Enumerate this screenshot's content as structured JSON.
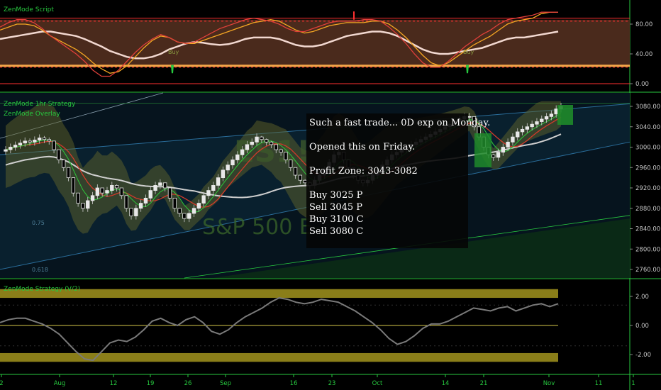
{
  "panes": {
    "top": {
      "title": "ZenMode Script",
      "ticks": [
        {
          "v": 80,
          "label": "80.00"
        },
        {
          "v": 40,
          "label": "40.00"
        },
        {
          "v": 0,
          "label": "0.00"
        }
      ]
    },
    "main": {
      "titles": [
        "ZenMode 1hr Strategy",
        "ZenMode Overlay"
      ],
      "ticks": [
        {
          "v": 3080,
          "label": "3080.00"
        },
        {
          "v": 3040,
          "label": "3040.00"
        },
        {
          "v": 3000,
          "label": "3000.00"
        },
        {
          "v": 2960,
          "label": "2960.00"
        },
        {
          "v": 2920,
          "label": "2920.00"
        },
        {
          "v": 2880,
          "label": "2880.00"
        },
        {
          "v": 2840,
          "label": "2840.00"
        },
        {
          "v": 2800,
          "label": "2800.00"
        },
        {
          "v": 2760,
          "label": "2760.00"
        }
      ],
      "watermark_symbol": "ES1!",
      "watermark_name": "S&P 500 E-",
      "fib_labels": [
        {
          "label": "0.75"
        },
        {
          "label": "0.618"
        }
      ]
    },
    "bottom": {
      "title": "ZenMode Strategy (V/2)",
      "ticks": [
        {
          "v": 2,
          "label": "2.00"
        },
        {
          "v": 0,
          "label": "0.00"
        },
        {
          "v": -2,
          "label": "-2.00"
        }
      ]
    }
  },
  "signals": [
    {
      "label": "Buy"
    },
    {
      "label": "Buy"
    }
  ],
  "annotation": {
    "lines": [
      "Such a fast trade... 0D exp on Monday.",
      "Opened this on Friday.",
      "Profit Zone: 3043-3082",
      "Buy 3025 P",
      "Sell 3045 P",
      "Buy 3100 C",
      "Sell 3080 C"
    ]
  },
  "x_axis": [
    "2",
    "Aug",
    "12",
    "19",
    "26",
    "Sep",
    "16",
    "23",
    "Oct",
    "14",
    "21",
    "Nov",
    "11",
    "1"
  ],
  "colors": {
    "accent": "#27c93f",
    "band_fill": "#4a2a1c",
    "orange": "#f5a623",
    "red": "#e0403a",
    "white_line": "#f2d8d0",
    "zone_fill": "#b8a822"
  },
  "chart_data": [
    {
      "type": "line",
      "title": "ZenMode Script",
      "ylim": [
        -5,
        98
      ],
      "x": [
        0,
        1,
        2,
        3,
        4,
        5,
        6,
        7,
        8,
        9,
        10,
        11,
        12,
        13,
        14,
        15,
        16,
        17,
        18,
        19,
        20,
        21,
        22,
        23,
        24,
        25,
        26,
        27,
        28,
        29,
        30,
        31,
        32,
        33,
        34,
        35,
        36,
        37,
        38,
        39,
        40,
        41,
        42,
        43,
        44,
        45,
        46,
        47,
        48,
        49,
        50,
        51,
        52,
        53,
        54,
        55,
        56,
        57,
        58,
        59,
        60,
        61,
        62,
        63,
        64,
        65,
        66
      ],
      "series": [
        {
          "values": [
            60,
            62,
            64,
            66,
            68,
            70,
            70,
            68,
            66,
            64,
            60,
            55,
            50,
            44,
            40,
            36,
            34,
            34,
            36,
            40,
            46,
            50,
            54,
            56,
            55,
            53,
            52,
            53,
            56,
            60,
            62,
            62,
            62,
            60,
            56,
            52,
            50,
            50,
            52,
            56,
            60,
            64,
            66,
            68,
            70,
            70,
            68,
            64,
            58,
            52,
            46,
            42,
            40,
            40,
            42,
            44,
            46,
            48,
            52,
            56,
            60,
            62,
            62,
            64,
            66,
            68,
            70
          ]
        },
        {
          "values": [
            72,
            76,
            80,
            80,
            78,
            72,
            64,
            58,
            52,
            46,
            38,
            28,
            20,
            14,
            16,
            24,
            36,
            48,
            58,
            64,
            62,
            56,
            54,
            54,
            58,
            62,
            66,
            70,
            74,
            78,
            82,
            84,
            86,
            84,
            78,
            72,
            68,
            70,
            74,
            78,
            80,
            82,
            82,
            82,
            84,
            84,
            80,
            72,
            62,
            50,
            38,
            28,
            24,
            28,
            36,
            44,
            52,
            58,
            64,
            72,
            80,
            84,
            86,
            88,
            94,
            96,
            96
          ]
        },
        {
          "values": [
            76,
            82,
            86,
            86,
            82,
            74,
            64,
            56,
            48,
            40,
            30,
            18,
            10,
            10,
            18,
            30,
            42,
            52,
            60,
            66,
            62,
            56,
            54,
            56,
            62,
            68,
            74,
            78,
            82,
            86,
            88,
            86,
            84,
            80,
            74,
            70,
            70,
            74,
            78,
            82,
            84,
            84,
            84,
            86,
            86,
            84,
            76,
            66,
            54,
            40,
            28,
            22,
            22,
            30,
            40,
            50,
            58,
            66,
            72,
            80,
            86,
            88,
            90,
            92,
            96,
            96,
            96
          ]
        }
      ]
    },
    {
      "type": "candlestick",
      "title": "ZenMode 1hr Strategy",
      "ylim": [
        2740,
        3100
      ],
      "x": [
        0,
        1,
        2,
        3,
        4,
        5,
        6,
        7,
        8,
        9,
        10,
        11,
        12,
        13,
        14,
        15,
        16,
        17,
        18,
        19,
        20,
        21,
        22,
        23,
        24,
        25,
        26,
        27,
        28,
        29,
        30,
        31,
        32,
        33,
        34,
        35,
        36,
        37,
        38,
        39,
        40,
        41,
        42,
        43,
        44,
        45,
        46,
        47,
        48,
        49,
        50,
        51,
        52,
        53,
        54,
        55,
        56,
        57,
        58,
        59,
        60,
        61,
        62,
        63,
        64,
        65,
        66,
        67,
        68,
        69,
        70,
        71,
        72,
        73,
        74,
        75,
        76,
        77,
        78,
        79,
        80,
        81,
        82,
        83,
        84,
        85,
        86,
        87,
        88,
        89,
        90,
        91,
        92,
        93,
        94,
        95,
        96,
        97,
        98,
        99,
        100,
        101,
        102,
        103,
        104,
        105,
        106,
        107,
        108,
        109,
        110,
        111,
        112,
        113,
        114,
        115
      ],
      "open": [
        2992,
        2995,
        3000,
        3004,
        3008,
        3012,
        3010,
        3014,
        3018,
        3015,
        3012,
        2995,
        2975,
        2960,
        2940,
        2910,
        2890,
        2880,
        2895,
        2905,
        2920,
        2910,
        2915,
        2925,
        2920,
        2905,
        2880,
        2865,
        2880,
        2890,
        2900,
        2915,
        2925,
        2930,
        2920,
        2900,
        2880,
        2870,
        2860,
        2870,
        2880,
        2890,
        2905,
        2915,
        2925,
        2940,
        2955,
        2965,
        2975,
        2985,
        2995,
        3005,
        3010,
        3020,
        3015,
        3010,
        3005,
        2995,
        2990,
        2975,
        2960,
        2945,
        2935,
        2930,
        2925,
        2935,
        2945,
        2955,
        2970,
        2985,
        2990,
        2975,
        2960,
        2945,
        2935,
        2930,
        2935,
        2945,
        2955,
        2965,
        2975,
        2985,
        2990,
        2995,
        3000,
        3005,
        3010,
        3015,
        3020,
        3025,
        3030,
        3035,
        3040,
        3045,
        3050,
        3055,
        3060,
        3060,
        3040,
        3020,
        3000,
        2985,
        2980,
        2990,
        3000,
        3010,
        3020,
        3030,
        3035,
        3040,
        3045,
        3050,
        3055,
        3060,
        3065,
        3075
      ],
      "close": [
        2995,
        3000,
        3004,
        3008,
        3012,
        3010,
        3014,
        3018,
        3015,
        3012,
        2995,
        2975,
        2960,
        2940,
        2910,
        2890,
        2880,
        2895,
        2905,
        2920,
        2910,
        2915,
        2925,
        2920,
        2905,
        2880,
        2865,
        2880,
        2890,
        2900,
        2915,
        2925,
        2930,
        2920,
        2900,
        2880,
        2870,
        2860,
        2870,
        2880,
        2890,
        2905,
        2915,
        2925,
        2940,
        2955,
        2965,
        2975,
        2985,
        2995,
        3005,
        3010,
        3020,
        3015,
        3010,
        3005,
        2995,
        2990,
        2975,
        2960,
        2945,
        2935,
        2930,
        2925,
        2935,
        2945,
        2955,
        2970,
        2985,
        2990,
        2975,
        2960,
        2945,
        2935,
        2930,
        2935,
        2945,
        2955,
        2965,
        2975,
        2985,
        2990,
        2995,
        3000,
        3005,
        3010,
        3015,
        3020,
        3025,
        3030,
        3035,
        3040,
        3045,
        3050,
        3055,
        3060,
        3060,
        3040,
        3020,
        3000,
        2985,
        2980,
        2990,
        3000,
        3010,
        3020,
        3030,
        3035,
        3040,
        3045,
        3050,
        3055,
        3060,
        3065,
        3075,
        3080
      ],
      "high": [
        3002,
        3007,
        3011,
        3015,
        3019,
        3017,
        3021,
        3025,
        3022,
        3019,
        3002,
        2982,
        2967,
        2947,
        2917,
        2897,
        2887,
        2902,
        2912,
        2927,
        2917,
        2922,
        2932,
        2927,
        2912,
        2887,
        2872,
        2887,
        2897,
        2907,
        2922,
        2932,
        2937,
        2927,
        2907,
        2887,
        2877,
        2867,
        2877,
        2887,
        2897,
        2912,
        2922,
        2932,
        2947,
        2962,
        2972,
        2982,
        2992,
        3002,
        3012,
        3017,
        3027,
        3022,
        3017,
        3012,
        3002,
        2997,
        2982,
        2967,
        2952,
        2942,
        2937,
        2932,
        2942,
        2952,
        2962,
        2977,
        2992,
        2997,
        2982,
        2967,
        2952,
        2942,
        2937,
        2942,
        2952,
        2962,
        2972,
        2982,
        2992,
        2997,
        3002,
        3007,
        3012,
        3017,
        3022,
        3027,
        3032,
        3037,
        3042,
        3047,
        3052,
        3057,
        3062,
        3067,
        3067,
        3047,
        3027,
        3007,
        2992,
        2987,
        2997,
        3007,
        3017,
        3027,
        3037,
        3042,
        3047,
        3052,
        3057,
        3062,
        3067,
        3072,
        3082,
        3087
      ],
      "low": [
        2985,
        2988,
        2993,
        2997,
        3001,
        3003,
        3003,
        3007,
        3008,
        3005,
        2988,
        2968,
        2953,
        2933,
        2903,
        2883,
        2873,
        2873,
        2888,
        2898,
        2903,
        2903,
        2908,
        2913,
        2898,
        2873,
        2858,
        2858,
        2873,
        2883,
        2893,
        2908,
        2918,
        2913,
        2893,
        2873,
        2863,
        2853,
        2853,
        2863,
        2873,
        2883,
        2898,
        2908,
        2918,
        2933,
        2948,
        2958,
        2968,
        2978,
        2988,
        2998,
        3003,
        3008,
        3003,
        2998,
        2988,
        2983,
        2968,
        2953,
        2938,
        2928,
        2923,
        2918,
        2918,
        2928,
        2938,
        2948,
        2963,
        2978,
        2968,
        2953,
        2938,
        2928,
        2923,
        2923,
        2928,
        2938,
        2948,
        2958,
        2968,
        2978,
        2983,
        2988,
        2993,
        2998,
        3003,
        3008,
        3013,
        3018,
        3023,
        3028,
        3033,
        3038,
        3043,
        3048,
        3053,
        3033,
        3013,
        2993,
        2978,
        2973,
        2973,
        2983,
        2993,
        3003,
        3013,
        3023,
        3028,
        3033,
        3038,
        3043,
        3048,
        3053,
        3058,
        3068
      ]
    },
    {
      "type": "line",
      "title": "ZenMode Strategy (V/2)",
      "ylim": [
        -2.9,
        2.9
      ],
      "x": [
        0,
        1,
        2,
        3,
        4,
        5,
        6,
        7,
        8,
        9,
        10,
        11,
        12,
        13,
        14,
        15,
        16,
        17,
        18,
        19,
        20,
        21,
        22,
        23,
        24,
        25,
        26,
        27,
        28,
        29,
        30,
        31,
        32,
        33,
        34,
        35,
        36,
        37,
        38,
        39,
        40,
        41,
        42,
        43,
        44,
        45,
        46,
        47,
        48,
        49,
        50,
        51,
        52,
        53,
        54,
        55,
        56,
        57,
        58,
        59,
        60,
        61,
        62,
        63,
        64,
        65,
        66
      ],
      "values": [
        0.2,
        0.4,
        0.5,
        0.5,
        0.3,
        0.1,
        -0.2,
        -0.6,
        -1.2,
        -1.8,
        -2.3,
        -2.4,
        -1.8,
        -1.2,
        -1.0,
        -1.1,
        -0.8,
        -0.3,
        0.3,
        0.5,
        0.2,
        0.0,
        0.4,
        0.6,
        0.2,
        -0.4,
        -0.6,
        -0.3,
        0.2,
        0.6,
        0.9,
        1.2,
        1.6,
        1.9,
        1.8,
        1.6,
        1.5,
        1.6,
        1.8,
        1.7,
        1.6,
        1.3,
        1.0,
        0.6,
        0.2,
        -0.3,
        -0.9,
        -1.3,
        -1.1,
        -0.7,
        -0.2,
        0.1,
        0.1,
        0.3,
        0.6,
        0.9,
        1.2,
        1.1,
        1.0,
        1.2,
        1.3,
        1.0,
        1.2,
        1.4,
        1.5,
        1.3,
        1.5
      ]
    }
  ]
}
